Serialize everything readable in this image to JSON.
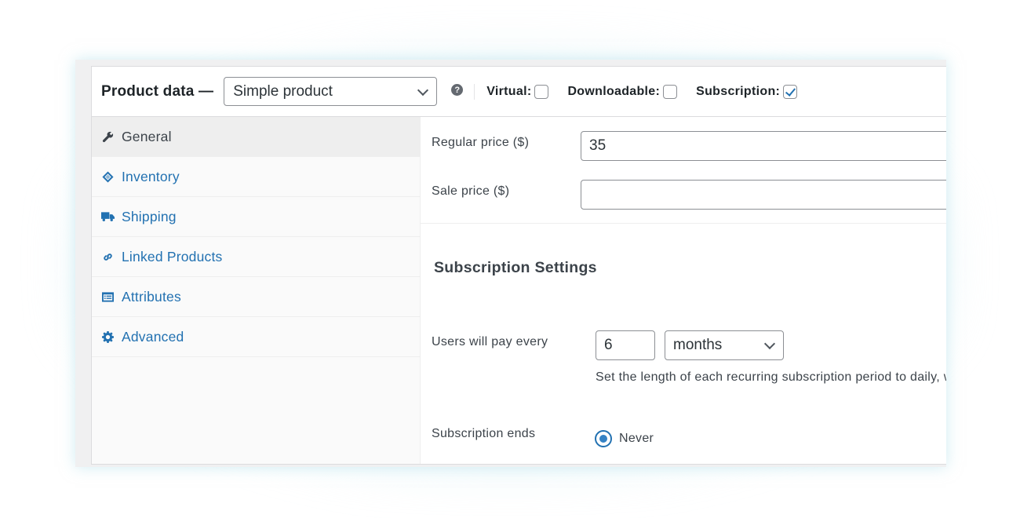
{
  "header": {
    "title": "Product data —",
    "product_type": {
      "selected": "Simple product"
    },
    "help_icon": "help-icon",
    "options": [
      {
        "label": "Virtual:",
        "checked": false
      },
      {
        "label": "Downloadable:",
        "checked": false
      },
      {
        "label": "Subscription:",
        "checked": true
      }
    ]
  },
  "tabs": [
    {
      "label": "General",
      "icon": "wrench-icon",
      "active": true
    },
    {
      "label": "Inventory",
      "icon": "tag-icon",
      "active": false
    },
    {
      "label": "Shipping",
      "icon": "truck-icon",
      "active": false
    },
    {
      "label": "Linked Products",
      "icon": "link-icon",
      "active": false
    },
    {
      "label": "Attributes",
      "icon": "list-card-icon",
      "active": false
    },
    {
      "label": "Advanced",
      "icon": "gear-icon",
      "active": false
    }
  ],
  "general": {
    "regular_price": {
      "label": "Regular price ($)",
      "value": "35"
    },
    "sale_price": {
      "label": "Sale price ($)",
      "value": ""
    },
    "subscription_settings": {
      "title": "Subscription Settings",
      "billing": {
        "label": "Users will pay every",
        "interval": "6",
        "period": "months",
        "description": "Set the length of each recurring subscription period to daily, w"
      },
      "ends": {
        "label": "Subscription ends",
        "option": "Never",
        "selected": true
      }
    }
  },
  "colors": {
    "accent": "#2271b1",
    "text": "#3c434a",
    "border": "#8c8f94"
  }
}
